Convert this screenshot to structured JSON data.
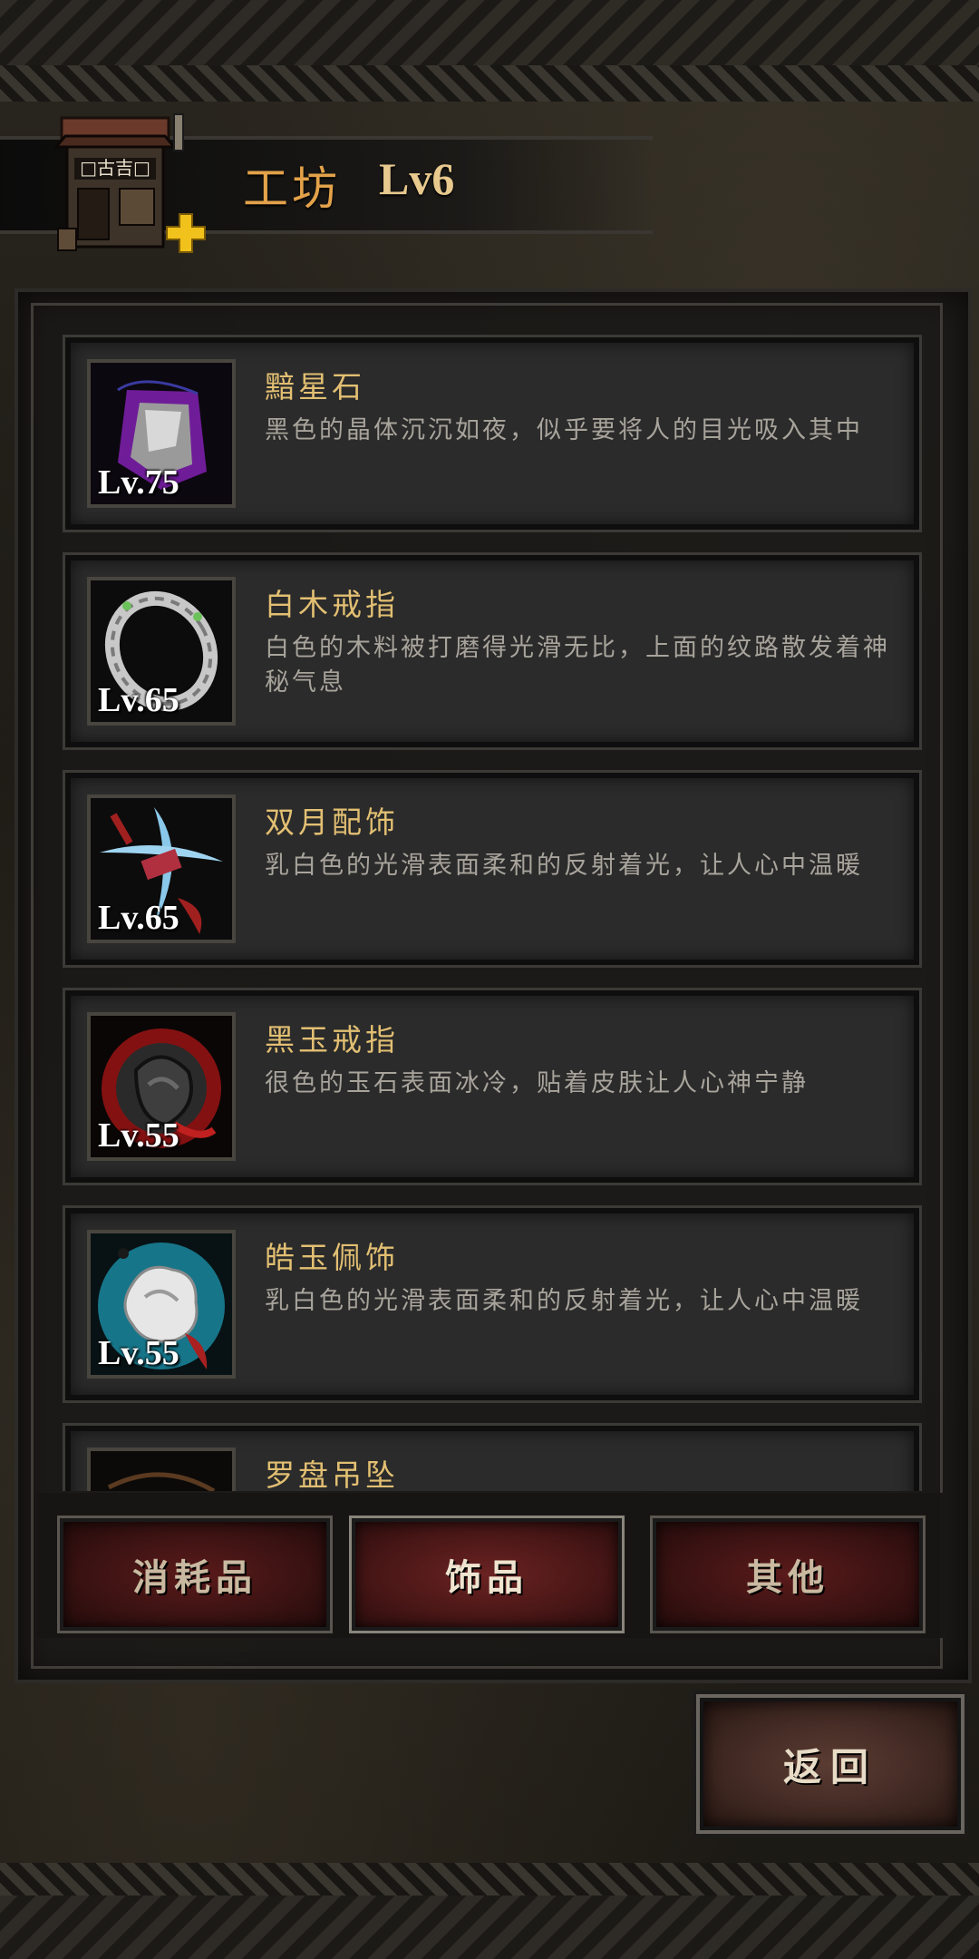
{
  "header": {
    "title": "工坊",
    "level": "Lv6"
  },
  "items": [
    {
      "name": "黯星石",
      "level": "Lv.75",
      "desc": "黑色的晶体沉沉如夜，似乎要将人的目光吸入其中",
      "icon": "dark-star-stone-icon",
      "color": "#8a2bbf"
    },
    {
      "name": "白木戒指",
      "level": "Lv.65",
      "desc": "白色的木料被打磨得光滑无比，上面的纹路散发着神秘气息",
      "icon": "white-wood-ring-icon",
      "color": "#cfcfcf"
    },
    {
      "name": "双月配饰",
      "level": "Lv.65",
      "desc": "乳白色的光滑表面柔和的反射着光，让人心中温暖",
      "icon": "twin-moon-ornament-icon",
      "color": "#6fb6e0"
    },
    {
      "name": "黑玉戒指",
      "level": "Lv.55",
      "desc": "很色的玉石表面冰冷，贴着皮肤让人心神宁静",
      "icon": "black-jade-ring-icon",
      "color": "#c0201f"
    },
    {
      "name": "皓玉佩饰",
      "level": "Lv.55",
      "desc": "乳白色的光滑表面柔和的反射着光，让人心中温暖",
      "icon": "white-jade-pendant-icon",
      "color": "#2a9bb0"
    },
    {
      "name": "罗盘吊坠",
      "level": "",
      "desc": "",
      "icon": "compass-pendant-icon",
      "color": "#5a3a20"
    }
  ],
  "tabs": [
    {
      "label": "消耗品",
      "active": false
    },
    {
      "label": "饰品",
      "active": true
    },
    {
      "label": "其他",
      "active": false
    }
  ],
  "back_button": {
    "label": "返回"
  }
}
